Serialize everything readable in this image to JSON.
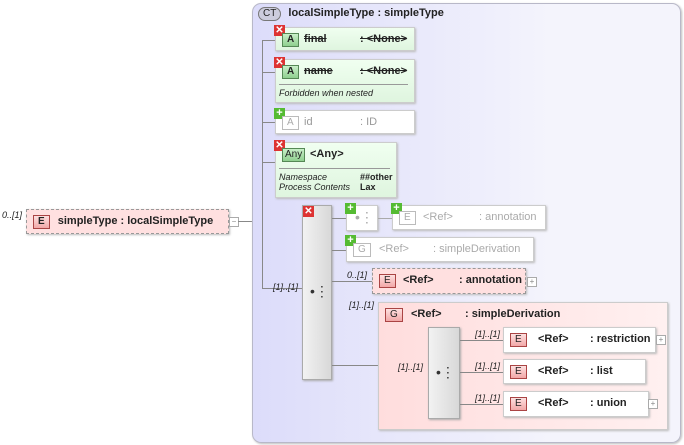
{
  "root": {
    "occurrence": "0..[1]",
    "badge": "E",
    "name": "simpleType",
    "type": ": localSimpleType"
  },
  "complex_type": {
    "badge": "CT",
    "title": "localSimpleType : simpleType"
  },
  "attributes": [
    {
      "badge": "A",
      "name": "final",
      "type": ": <None>",
      "status": "prohibited"
    },
    {
      "badge": "A",
      "name": "name",
      "type": ": <None>",
      "status": "prohibited",
      "note": "Forbidden when nested"
    },
    {
      "badge": "A",
      "name": "id",
      "type": ": ID",
      "status": "optional"
    }
  ],
  "any": {
    "badge": "Any",
    "name": "<Any>",
    "props": [
      {
        "label": "Namespace",
        "value": "##other"
      },
      {
        "label": "Process Contents",
        "value": "Lax"
      }
    ]
  },
  "sequence": {
    "occurrence": "[1]..[1]"
  },
  "ghost_annotation": {
    "badge": "E",
    "name": "<Ref>",
    "type": ": annotation"
  },
  "ghost_group": {
    "badge": "G",
    "name": "<Ref>",
    "type": ": simpleDerivation"
  },
  "annotation": {
    "occurrence": "0..[1]",
    "badge": "E",
    "name": "<Ref>",
    "type": ": annotation"
  },
  "group": {
    "occurrence": "[1]..[1]",
    "badge": "G",
    "name": "<Ref>",
    "type": ": simpleDerivation",
    "choice_occurrence": "[1]..[1]",
    "children": [
      {
        "occurrence": "[1]..[1]",
        "badge": "E",
        "name": "<Ref>",
        "type": ": restriction"
      },
      {
        "occurrence": "[1]..[1]",
        "badge": "E",
        "name": "<Ref>",
        "type": ": list"
      },
      {
        "occurrence": "[1]..[1]",
        "badge": "E",
        "name": "<Ref>",
        "type": ": union"
      }
    ]
  }
}
